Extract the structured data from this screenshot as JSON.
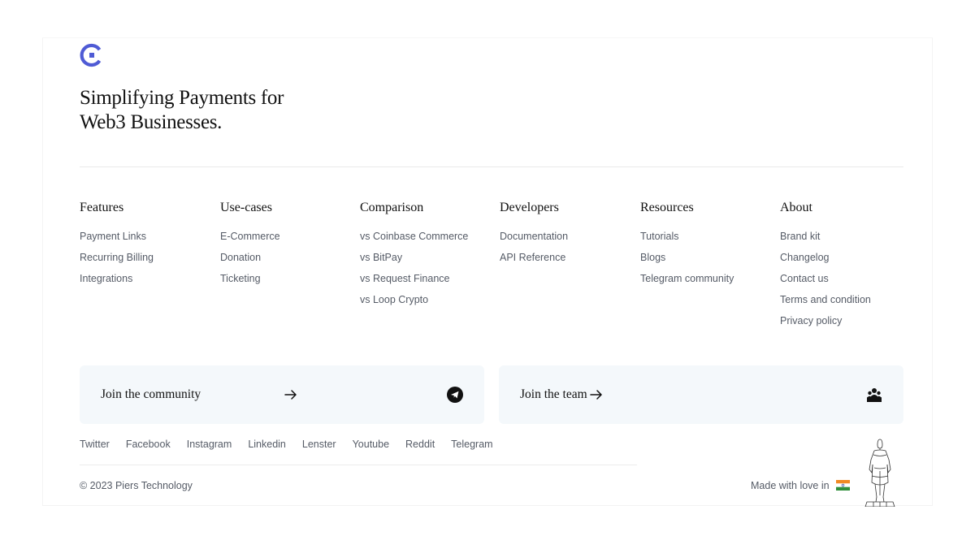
{
  "brand": {
    "tagline_line1": "Simplifying Payments for",
    "tagline_line2": "Web3 Businesses.",
    "logo_icon": "brand-logo-icon",
    "accent": "#4f5bd5"
  },
  "columns": [
    {
      "title": "Features",
      "links": [
        "Payment Links",
        "Recurring Billing",
        "Integrations"
      ]
    },
    {
      "title": "Use-cases",
      "links": [
        "E-Commerce",
        "Donation",
        "Ticketing"
      ]
    },
    {
      "title": "Comparison",
      "links": [
        "vs Coinbase Commerce",
        "vs BitPay",
        "vs Request Finance",
        "vs Loop Crypto"
      ]
    },
    {
      "title": "Developers",
      "links": [
        "Documentation",
        "API Reference"
      ]
    },
    {
      "title": "Resources",
      "links": [
        "Tutorials",
        "Blogs",
        "Telegram community"
      ]
    },
    {
      "title": "About",
      "links": [
        "Brand kit",
        "Changelog",
        "Contact us",
        "Terms and condition",
        "Privacy policy"
      ]
    }
  ],
  "cards": {
    "community": {
      "label": "Join the community",
      "icon": "telegram-icon"
    },
    "team": {
      "label": "Join the team",
      "icon": "team-icon"
    },
    "background": "#f4f8fb"
  },
  "social": [
    "Twitter",
    "Facebook",
    "Instagram",
    "Linkedin",
    "Lenster",
    "Youtube",
    "Reddit",
    "Telegram"
  ],
  "bottom": {
    "copyright": "© 2023 Piers Technology",
    "made_with": "Made with love in",
    "flag_icon": "india-flag-icon",
    "illustration": "statue-illustration"
  }
}
